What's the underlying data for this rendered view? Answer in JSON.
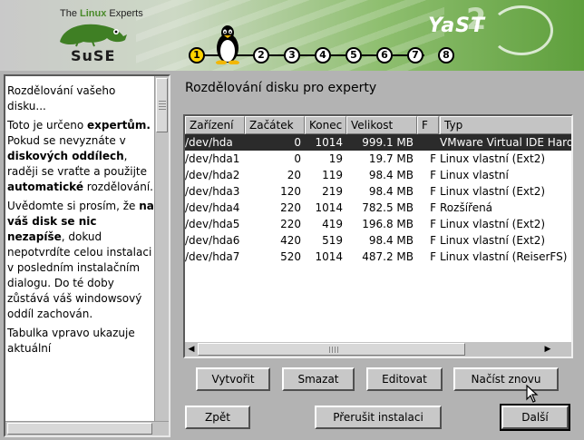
{
  "header": {
    "brand_prefix": "The ",
    "brand_linux": "Linux",
    "brand_suffix": " Experts",
    "logo_word": "SuSE",
    "yast_logo": "YaST",
    "yast_version": "2",
    "steps": [
      "1",
      "2",
      "3",
      "4",
      "5",
      "6",
      "7",
      "8"
    ],
    "active_step": 1
  },
  "help": {
    "p1": "Rozdělování vašeho disku...",
    "p2_a": "Toto je určeno ",
    "p2_b": "expertům.",
    "p2_c": " Pokud se nevyznáte v ",
    "p2_d": "diskových oddílech",
    "p2_e": ", raději se vraťte a použijte ",
    "p2_f": "automatické",
    "p2_g": " rozdělování.",
    "p3_a": "Uvědomte si prosím, že ",
    "p3_b": "na váš disk se nic nezapíše",
    "p3_c": ", dokud nepotvrdíte celou instalaci v posledním instalačním dialogu. Do té doby zůstává váš windowsový oddíl zachován.",
    "p4": "Tabulka vpravo ukazuje aktuální"
  },
  "main": {
    "title": "Rozdělování disku pro experty",
    "columns": [
      "Zařízení",
      "Začátek",
      "Konec",
      "Velikost",
      "F",
      "Typ"
    ],
    "rows": [
      {
        "device": "/dev/hda",
        "start": "0",
        "end": "1014",
        "size": "999.1 MB",
        "f": "",
        "type": "VMware Virtual IDE Hard Drive"
      },
      {
        "device": "/dev/hda1",
        "start": "0",
        "end": "19",
        "size": "19.7 MB",
        "f": "F",
        "type": "Linux vlastní (Ext2)"
      },
      {
        "device": "/dev/hda2",
        "start": "20",
        "end": "119",
        "size": "98.4 MB",
        "f": "F",
        "type": "Linux vlastní"
      },
      {
        "device": "/dev/hda3",
        "start": "120",
        "end": "219",
        "size": "98.4 MB",
        "f": "F",
        "type": "Linux vlastní (Ext2)"
      },
      {
        "device": "/dev/hda4",
        "start": "220",
        "end": "1014",
        "size": "782.5 MB",
        "f": "F",
        "type": "Rozšířená"
      },
      {
        "device": "/dev/hda5",
        "start": "220",
        "end": "419",
        "size": "196.8 MB",
        "f": "F",
        "type": "Linux vlastní (Ext2)"
      },
      {
        "device": "/dev/hda6",
        "start": "420",
        "end": "519",
        "size": "98.4 MB",
        "f": "F",
        "type": "Linux vlastní (Ext2)"
      },
      {
        "device": "/dev/hda7",
        "start": "520",
        "end": "1014",
        "size": "487.2 MB",
        "f": "F",
        "type": "Linux vlastní (ReiserFS)"
      }
    ],
    "selected_row": 0
  },
  "buttons": {
    "create": "Vytvořit",
    "delete": "Smazat",
    "edit": "Editovat",
    "reload": "Načíst znovu",
    "back": "Zpět",
    "abort": "Přerušit instalaci",
    "next": "Další"
  },
  "colors": {
    "accent_green": "#5e9f3c",
    "selection": "#2b2b2b",
    "active_step": "#ffd400"
  }
}
